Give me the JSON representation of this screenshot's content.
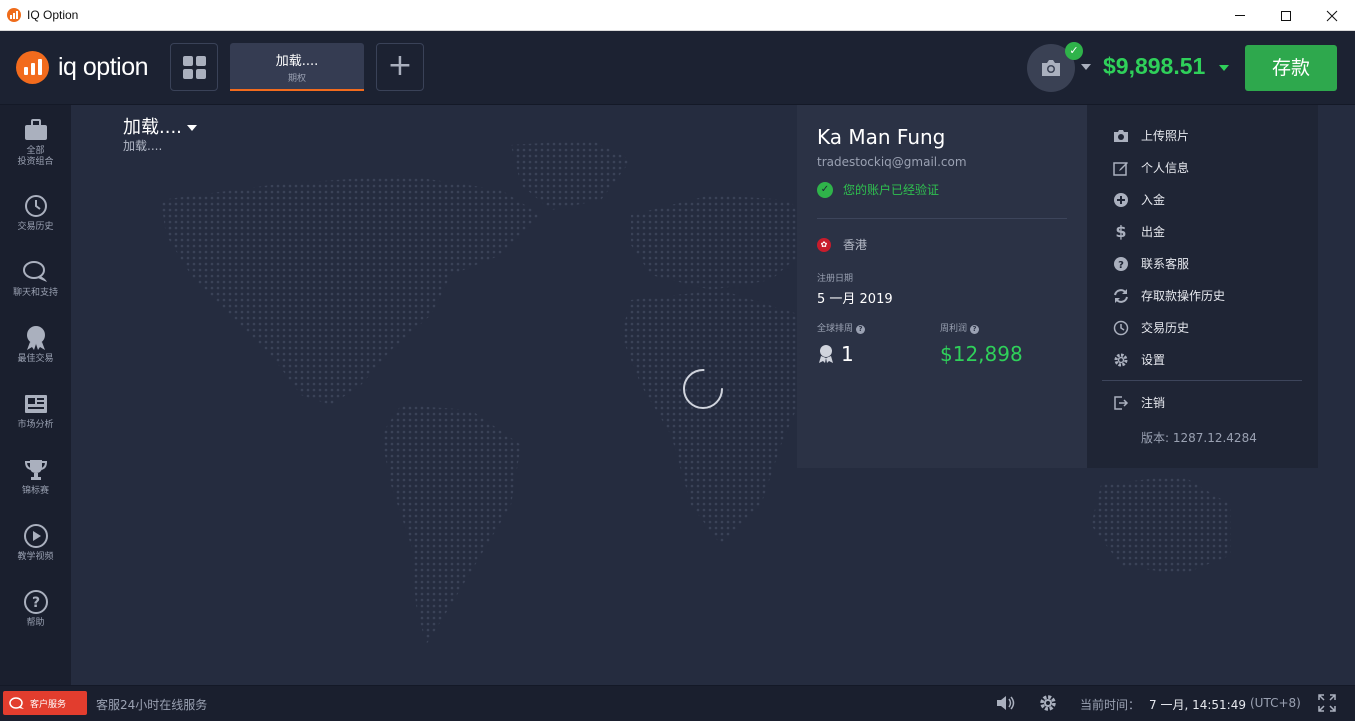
{
  "window": {
    "title": "IQ Option"
  },
  "header": {
    "logo_text": "iq option",
    "asset_tab": {
      "name": "加载....",
      "type": "期权"
    },
    "balance": "$9,898.51",
    "deposit_label": "存款",
    "brand_color": "#f26b1d",
    "accent_green": "#2fd05a"
  },
  "sidebar": {
    "items": [
      {
        "label": "全部\n投资组合",
        "icon": "briefcase-icon"
      },
      {
        "label": "交易历史",
        "icon": "history-icon"
      },
      {
        "label": "聊天和支持",
        "icon": "chat-icon"
      },
      {
        "label": "最佳交易",
        "icon": "award-icon"
      },
      {
        "label": "市场分析",
        "icon": "newspaper-icon"
      },
      {
        "label": "锦标赛",
        "icon": "trophy-icon"
      },
      {
        "label": "教学视频",
        "icon": "play-icon"
      },
      {
        "label": "帮助",
        "icon": "help-icon"
      }
    ]
  },
  "main": {
    "asset_title": "加载....",
    "asset_subtitle": "加载...."
  },
  "profile": {
    "name": "Ka Man Fung",
    "email": "tradestockiq@gmail.com",
    "verified_text": "您的账户已经验证",
    "region": "香港",
    "registration_label": "注册日期",
    "registration_date": "5 一月 2019",
    "rank_label": "全球排周",
    "rank_value": "1",
    "profit_label": "周利润",
    "profit_value": "$12,898"
  },
  "menu": {
    "items": [
      {
        "label": "上传照片",
        "icon": "camera-icon"
      },
      {
        "label": "个人信息",
        "icon": "edit-icon"
      },
      {
        "label": "入金",
        "icon": "plus-circle-icon"
      },
      {
        "label": "出金",
        "icon": "dollar-icon"
      },
      {
        "label": "联系客服",
        "icon": "question-circle-icon"
      },
      {
        "label": "存取款操作历史",
        "icon": "refresh-icon"
      },
      {
        "label": "交易历史",
        "icon": "history-icon"
      },
      {
        "label": "设置",
        "icon": "gear-icon"
      }
    ],
    "logout_label": "注销",
    "version": "版本: 1287.12.4284"
  },
  "footer": {
    "support_button": "客户服务",
    "support_text": "客服24小时在线服务",
    "time_label": "当前时间：",
    "time_value": "7 一月, 14:51:49",
    "timezone": "(UTC+8)"
  }
}
